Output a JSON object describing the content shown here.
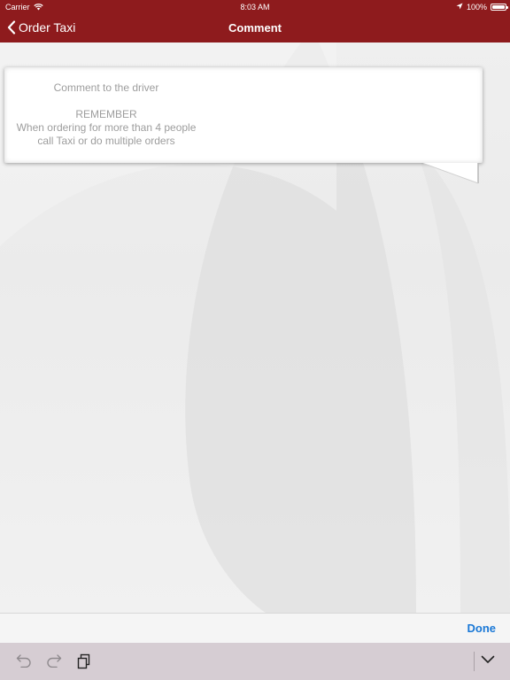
{
  "status_bar": {
    "carrier": "Carrier",
    "time": "8:03 AM",
    "battery": "100%",
    "battery_level": 1.0
  },
  "nav": {
    "back_label": "Order Taxi",
    "title": "Comment"
  },
  "comment": {
    "placeholder_lines": [
      "Comment to the driver",
      "",
      "REMEMBER",
      "When ordering for more than 4 people",
      "call Taxi or do multiple orders"
    ]
  },
  "accessory": {
    "done_label": "Done"
  },
  "keyboard_toolbar": {
    "icons": [
      "undo-icon",
      "redo-icon",
      "paste-icon",
      "chevron-down-icon"
    ]
  },
  "colors": {
    "header": "#8e1b1d",
    "done": "#1a78d6",
    "placeholder": "#9d9d9d"
  }
}
